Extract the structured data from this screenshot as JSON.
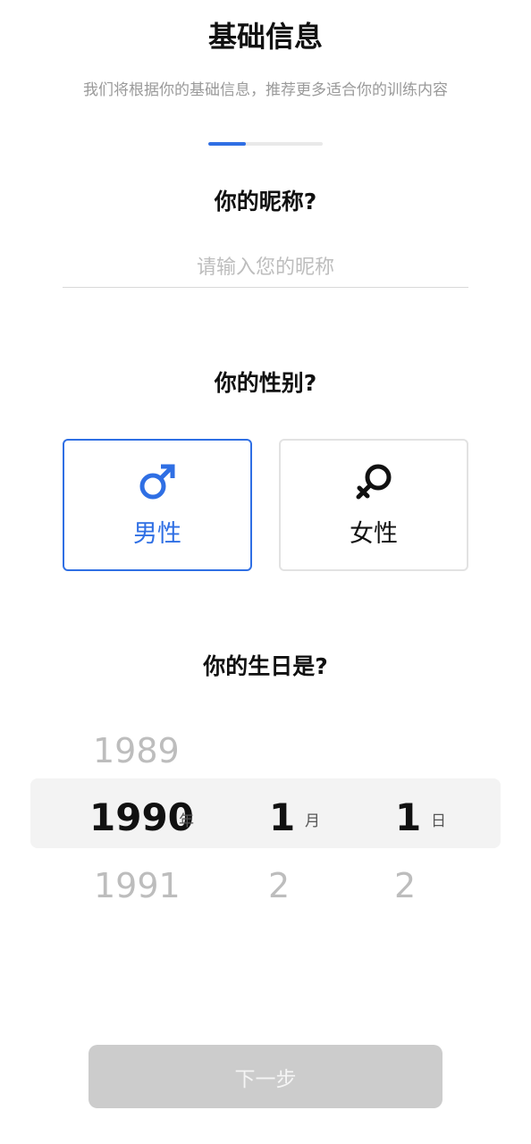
{
  "header": {
    "title": "基础信息",
    "subtitle": "我们将根据你的基础信息，推荐更多适合你的训练内容"
  },
  "progress": {
    "fraction": 0.33,
    "color": "#2f6fe4"
  },
  "nickname": {
    "question": "你的昵称?",
    "placeholder": "请输入您的昵称",
    "value": ""
  },
  "gender": {
    "question": "你的性别?",
    "options": [
      {
        "label": "男性",
        "icon": "male-symbol-icon",
        "selected": true
      },
      {
        "label": "女性",
        "icon": "female-symbol-icon",
        "selected": false
      }
    ],
    "selected_color": "#2f6fe4"
  },
  "birthday": {
    "question": "你的生日是?",
    "year": {
      "prev": "1989",
      "selected": "1990",
      "next": "1991",
      "unit": "年"
    },
    "month": {
      "selected": "1",
      "next": "2",
      "unit": "月"
    },
    "day": {
      "selected": "1",
      "next": "2",
      "unit": "日"
    }
  },
  "footer": {
    "next_label": "下一步",
    "enabled": false
  }
}
